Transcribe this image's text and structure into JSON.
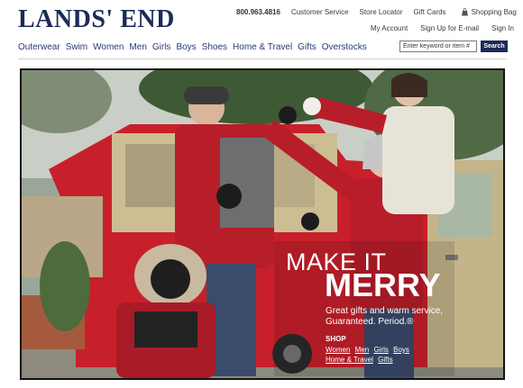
{
  "brand": {
    "logo_text": "LANDS' END"
  },
  "utility": {
    "phone": "800.963.4816",
    "links": [
      "Customer Service",
      "Store Locator",
      "Gift Cards"
    ],
    "bag_label": "Shopping Bag",
    "bag_icon": "shopping-bag-icon"
  },
  "account": {
    "links": [
      "My Account",
      "Sign Up for E-mail",
      "Sign In"
    ]
  },
  "nav": {
    "items": [
      "Outerwear",
      "Swim",
      "Women",
      "Men",
      "Girls",
      "Boys",
      "Shoes",
      "Home & Travel",
      "Gifts",
      "Overstocks"
    ]
  },
  "search": {
    "value": "Enter keyword or item #",
    "button_label": "Search"
  },
  "hero": {
    "headline_line1": "MAKE IT",
    "headline_line2": "MERRY",
    "subtext": "Great gifts and warm service, Guaranteed. Period.®",
    "shop_label": "SHOP",
    "shop_links": [
      "Women",
      "Men",
      "Girls",
      "Boys",
      "Home & Travel",
      "Gifts"
    ]
  },
  "colors": {
    "brand_navy": "#1c2b57",
    "nav_link": "#253b7a",
    "truck_red": "#c8202b",
    "jacket_red": "#b81d2a"
  }
}
